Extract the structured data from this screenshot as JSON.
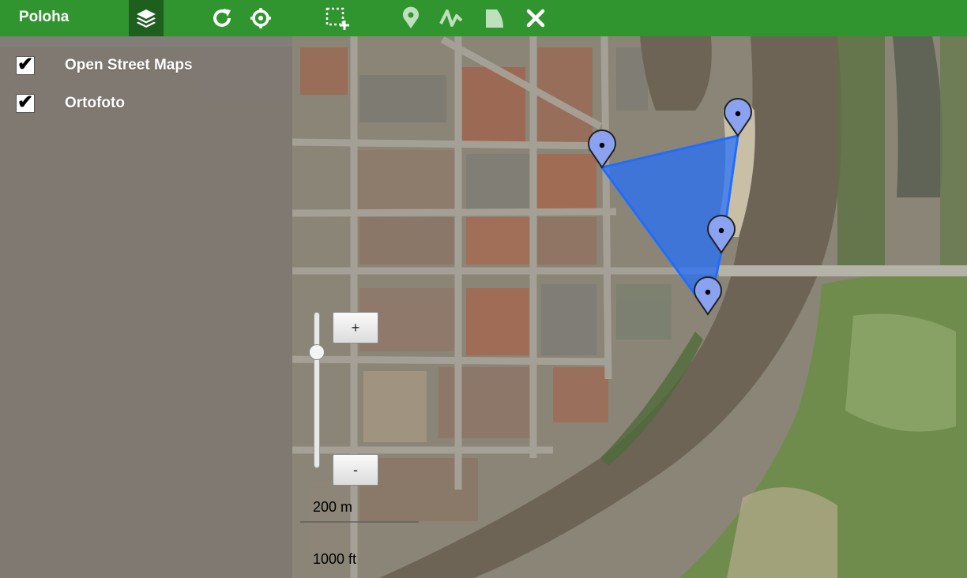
{
  "toolbar": {
    "title": "Poloha",
    "background": "#31952f",
    "buttons": [
      {
        "name": "layers-icon",
        "active": true
      },
      {
        "name": "refresh-icon",
        "active": false
      },
      {
        "name": "locate-icon",
        "active": false
      },
      {
        "name": "select-area-icon",
        "active": false
      },
      {
        "name": "marker-icon",
        "active": false,
        "disabled": true
      },
      {
        "name": "line-icon",
        "active": false,
        "disabled": true
      },
      {
        "name": "polygon-icon",
        "active": false,
        "disabled": true
      },
      {
        "name": "close-icon",
        "active": false
      }
    ]
  },
  "layers": [
    {
      "label": "Open Street Maps",
      "checked": true
    },
    {
      "label": "Ortofoto",
      "checked": true
    }
  ],
  "zoom": {
    "plus_label": "+",
    "minus_label": "-"
  },
  "scale": {
    "metric": "200 m",
    "imperial": "1000 ft"
  },
  "polygon": {
    "fill": "#1f6dff",
    "vertex_count": 4
  }
}
